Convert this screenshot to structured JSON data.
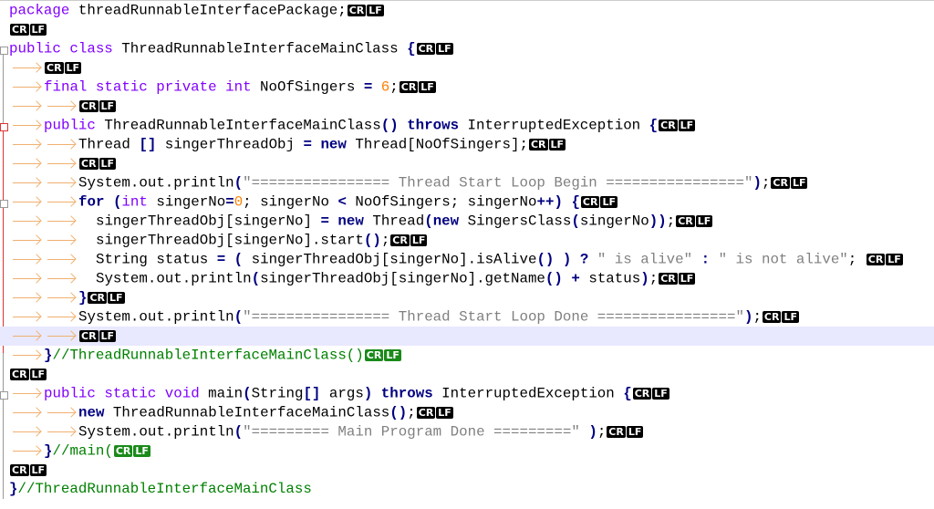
{
  "eol_label": [
    "CR",
    "LF"
  ],
  "colors": {
    "keyword": "#8000ff",
    "operator": "#000080",
    "number": "#ff8000",
    "string": "#808080",
    "comment": "#008000",
    "current_line": "#e8e8ff"
  },
  "lines": [
    {
      "tabs": 0,
      "tokens": [
        [
          "k",
          "package"
        ],
        [
          "t",
          " threadRunnableInterfacePackage;"
        ]
      ],
      "eol": "black"
    },
    {
      "tabs": 0,
      "tokens": [],
      "eol": "black"
    },
    {
      "tabs": 0,
      "tokens": [
        [
          "k",
          "public"
        ],
        [
          "t",
          " "
        ],
        [
          "k",
          "class"
        ],
        [
          "t",
          " ThreadRunnableInterfaceMainClass "
        ],
        [
          "b",
          "{"
        ]
      ],
      "eol": "black"
    },
    {
      "tabs": 1,
      "tokens": [],
      "eol": "black"
    },
    {
      "tabs": 1,
      "tokens": [
        [
          "k",
          "final"
        ],
        [
          "t",
          " "
        ],
        [
          "k",
          "static"
        ],
        [
          "t",
          " "
        ],
        [
          "k",
          "private"
        ],
        [
          "t",
          " "
        ],
        [
          "k",
          "int"
        ],
        [
          "t",
          " NoOfSingers "
        ],
        [
          "b",
          "="
        ],
        [
          "t",
          " "
        ],
        [
          "n",
          "6"
        ],
        [
          "t",
          ";"
        ]
      ],
      "eol": "black"
    },
    {
      "tabs": 2,
      "tokens": [],
      "eol": "black"
    },
    {
      "tabs": 1,
      "tokens": [
        [
          "k",
          "public"
        ],
        [
          "t",
          " ThreadRunnableInterfaceMainClass"
        ],
        [
          "b",
          "()"
        ],
        [
          "t",
          " "
        ],
        [
          "b",
          "throws"
        ],
        [
          "t",
          " InterruptedException "
        ],
        [
          "b",
          "{"
        ]
      ],
      "eol": "black"
    },
    {
      "tabs": 2,
      "tokens": [
        [
          "t",
          "Thread "
        ],
        [
          "b",
          "[]"
        ],
        [
          "t",
          " singerThreadObj "
        ],
        [
          "b",
          "="
        ],
        [
          "t",
          " "
        ],
        [
          "b",
          "new"
        ],
        [
          "t",
          " Thread[NoOfSingers];"
        ]
      ],
      "eol": "black"
    },
    {
      "tabs": 2,
      "tokens": [],
      "eol": "black"
    },
    {
      "tabs": 2,
      "tokens": [
        [
          "t",
          "System.out.println"
        ],
        [
          "b",
          "("
        ],
        [
          "s",
          "\"================ Thread Start Loop Begin ================\""
        ],
        [
          "b",
          ")"
        ],
        [
          "t",
          ";"
        ]
      ],
      "eol": "black"
    },
    {
      "tabs": 2,
      "tokens": [
        [
          "b",
          "for"
        ],
        [
          "t",
          " "
        ],
        [
          "b",
          "("
        ],
        [
          "k",
          "int"
        ],
        [
          "t",
          " singerNo"
        ],
        [
          "b",
          "="
        ],
        [
          "n",
          "0"
        ],
        [
          "t",
          "; singerNo "
        ],
        [
          "b",
          "<"
        ],
        [
          "t",
          " NoOfSingers; singerNo"
        ],
        [
          "b",
          "++)"
        ],
        [
          "t",
          " "
        ],
        [
          "b",
          "{"
        ]
      ],
      "eol": "black"
    },
    {
      "tabs": 2,
      "tokens": [
        [
          "t",
          "  singerThreadObj[singerNo] "
        ],
        [
          "b",
          "="
        ],
        [
          "t",
          " "
        ],
        [
          "b",
          "new"
        ],
        [
          "t",
          " Thread"
        ],
        [
          "b",
          "("
        ],
        [
          "b",
          "new"
        ],
        [
          "t",
          " SingersClass"
        ],
        [
          "b",
          "("
        ],
        [
          "t",
          "singerNo"
        ],
        [
          "b",
          "))"
        ],
        [
          "t",
          ";"
        ]
      ],
      "eol": "black"
    },
    {
      "tabs": 2,
      "tokens": [
        [
          "t",
          "  singerThreadObj[singerNo].start"
        ],
        [
          "b",
          "()"
        ],
        [
          "t",
          ";"
        ]
      ],
      "eol": "black"
    },
    {
      "tabs": 2,
      "tokens": [
        [
          "t",
          "  String status "
        ],
        [
          "b",
          "="
        ],
        [
          "t",
          " "
        ],
        [
          "b",
          "("
        ],
        [
          "t",
          " singerThreadObj[singerNo].isAlive"
        ],
        [
          "b",
          "()"
        ],
        [
          "t",
          " "
        ],
        [
          "b",
          ")"
        ],
        [
          "t",
          " "
        ],
        [
          "b",
          "?"
        ],
        [
          "t",
          " "
        ],
        [
          "s",
          "\" is alive\""
        ],
        [
          "t",
          " "
        ],
        [
          "b",
          ":"
        ],
        [
          "t",
          " "
        ],
        [
          "s",
          "\" is not alive\""
        ],
        [
          "t",
          "; "
        ]
      ],
      "eol": "black"
    },
    {
      "tabs": 2,
      "tokens": [
        [
          "t",
          "  System.out.println"
        ],
        [
          "b",
          "("
        ],
        [
          "t",
          "singerThreadObj[singerNo].getName"
        ],
        [
          "b",
          "()"
        ],
        [
          "t",
          " "
        ],
        [
          "b",
          "+"
        ],
        [
          "t",
          " status"
        ],
        [
          "b",
          ")"
        ],
        [
          "t",
          ";"
        ]
      ],
      "eol": "black"
    },
    {
      "tabs": 2,
      "tokens": [
        [
          "b",
          "}"
        ]
      ],
      "eol": "black"
    },
    {
      "tabs": 2,
      "tokens": [
        [
          "t",
          "System.out.println"
        ],
        [
          "b",
          "("
        ],
        [
          "s",
          "\"================ Thread Start Loop Done ================\""
        ],
        [
          "b",
          ")"
        ],
        [
          "t",
          ";"
        ]
      ],
      "eol": "black"
    },
    {
      "tabs": 2,
      "tokens": [],
      "eol": "black",
      "current": true
    },
    {
      "tabs": 1,
      "tokens": [
        [
          "b",
          "}"
        ],
        [
          "c",
          "//ThreadRunnableInterfaceMainClass()"
        ]
      ],
      "eol": "green"
    },
    {
      "tabs": 0,
      "tokens": [],
      "eol": "black"
    },
    {
      "tabs": 1,
      "tokens": [
        [
          "k",
          "public"
        ],
        [
          "t",
          " "
        ],
        [
          "k",
          "static"
        ],
        [
          "t",
          " "
        ],
        [
          "k",
          "void"
        ],
        [
          "t",
          " main"
        ],
        [
          "b",
          "("
        ],
        [
          "t",
          "String"
        ],
        [
          "b",
          "[]"
        ],
        [
          "t",
          " args"
        ],
        [
          "b",
          ")"
        ],
        [
          "t",
          " "
        ],
        [
          "b",
          "throws"
        ],
        [
          "t",
          " InterruptedException "
        ],
        [
          "b",
          "{"
        ]
      ],
      "eol": "black"
    },
    {
      "tabs": 2,
      "tokens": [
        [
          "b",
          "new"
        ],
        [
          "t",
          " ThreadRunnableInterfaceMainClass"
        ],
        [
          "b",
          "()"
        ],
        [
          "t",
          ";"
        ]
      ],
      "eol": "black"
    },
    {
      "tabs": 2,
      "tokens": [
        [
          "t",
          "System.out.println"
        ],
        [
          "b",
          "("
        ],
        [
          "s",
          "\"========= Main Program Done =========\""
        ],
        [
          "t",
          " "
        ],
        [
          "b",
          ")"
        ],
        [
          "t",
          ";"
        ]
      ],
      "eol": "black"
    },
    {
      "tabs": 1,
      "tokens": [
        [
          "b",
          "}"
        ],
        [
          "c",
          "//main("
        ]
      ],
      "eol": "green"
    },
    {
      "tabs": 0,
      "tokens": [],
      "eol": "black"
    },
    {
      "tabs": 0,
      "tokens": [
        [
          "b",
          "}"
        ],
        [
          "c",
          "//ThreadRunnableInterfaceMainClass"
        ]
      ],
      "eol": null
    }
  ]
}
